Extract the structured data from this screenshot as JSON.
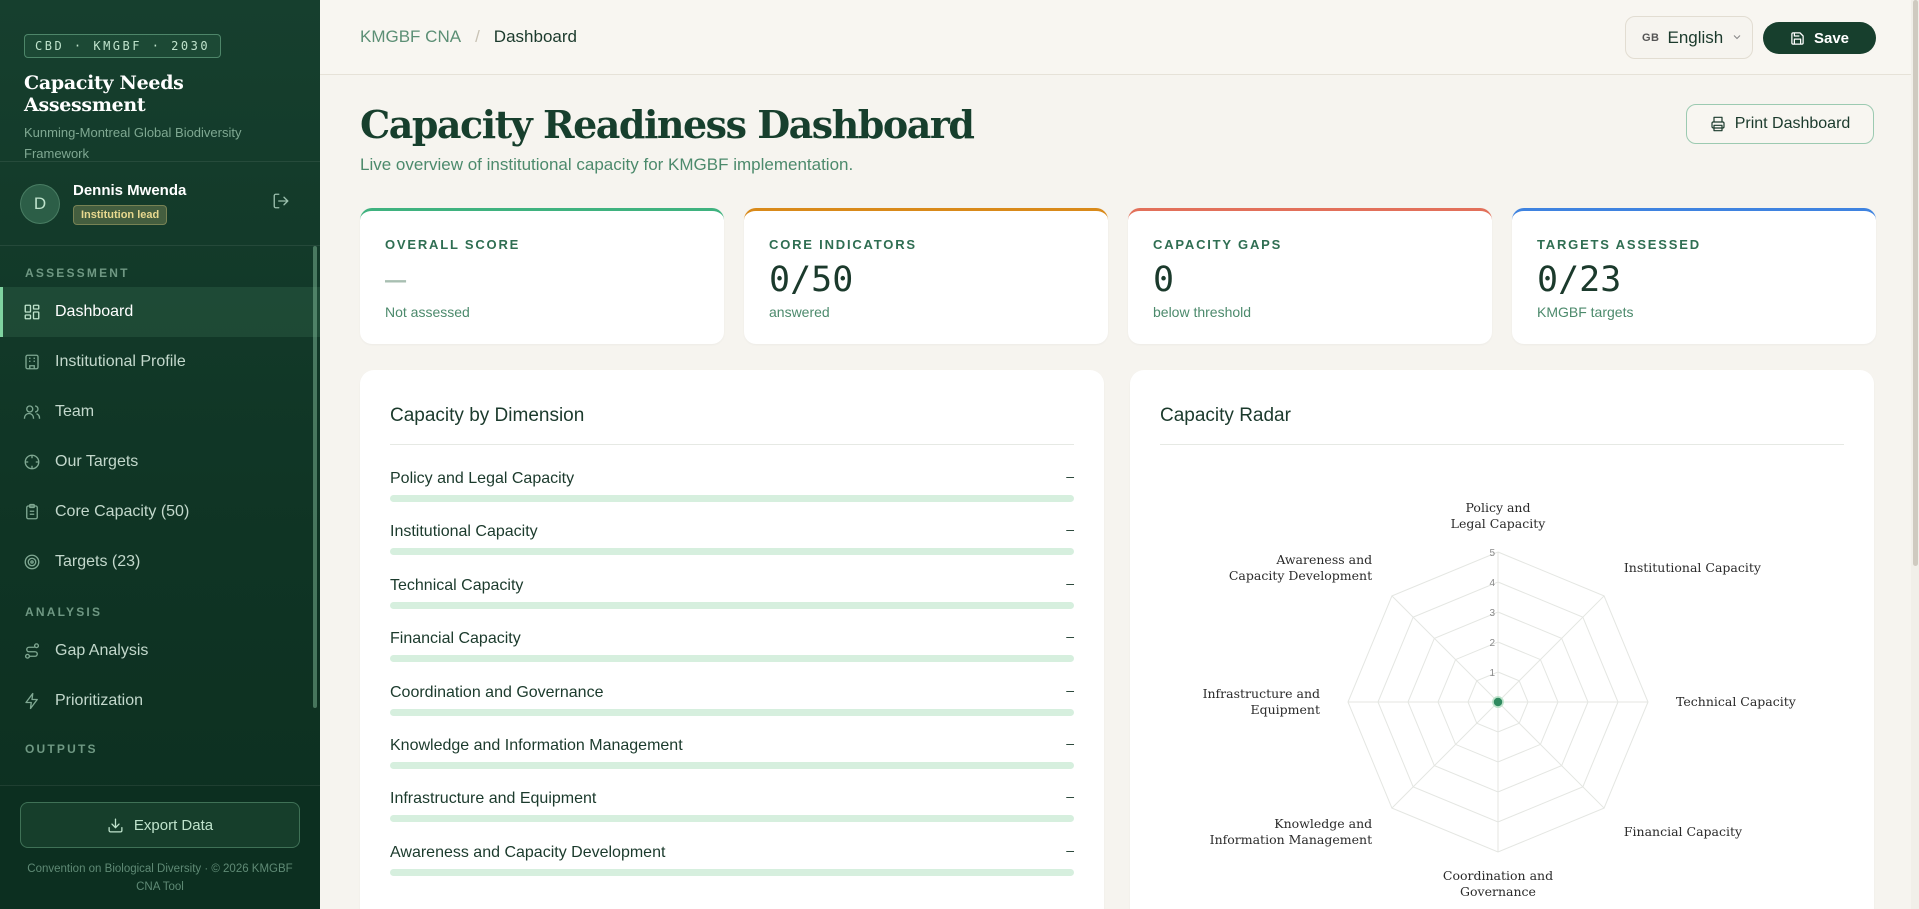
{
  "sidebar": {
    "tag": "CBD · KMGBF · 2030",
    "title": "Capacity Needs Assessment",
    "subtitle": "Kunming-Montreal Global Biodiversity Framework",
    "user": {
      "initial": "D",
      "name": "Dennis Mwenda",
      "role": "Institution lead"
    },
    "sections": {
      "assessment": "ASSESSMENT",
      "analysis": "ANALYSIS",
      "outputs": "OUTPUTS"
    },
    "items": [
      {
        "label": "Dashboard",
        "icon": "dashboard-grid-icon",
        "active": true
      },
      {
        "label": "Institutional Profile",
        "icon": "building-icon"
      },
      {
        "label": "Team",
        "icon": "users-icon"
      },
      {
        "label": "Our Targets",
        "icon": "crosshair-icon"
      },
      {
        "label": "Core Capacity (50)",
        "icon": "clipboard-icon"
      },
      {
        "label": "Targets (23)",
        "icon": "target-icon"
      },
      {
        "label": "Gap Analysis",
        "icon": "route-icon"
      },
      {
        "label": "Prioritization",
        "icon": "zap-icon"
      }
    ],
    "export_label": "Export Data",
    "footer": "Convention on Biological Diversity · © 2026 KMGBF CNA Tool"
  },
  "topbar": {
    "breadcrumb_root": "KMGBF CNA",
    "breadcrumb_sep": "/",
    "breadcrumb_current": "Dashboard",
    "language_flag": "GB",
    "language": "English",
    "save_label": "Save"
  },
  "page": {
    "title": "Capacity Readiness Dashboard",
    "subtitle": "Live overview of institutional capacity for KMGBF implementation.",
    "print_label": "Print Dashboard"
  },
  "stats": [
    {
      "label": "OVERALL SCORE",
      "value": "—",
      "note": "Not assessed",
      "color": "#3fb27f"
    },
    {
      "label": "CORE INDICATORS",
      "value": "0/50",
      "note": "answered",
      "color": "#d98a1a"
    },
    {
      "label": "CAPACITY GAPS",
      "value": "0",
      "note": "below threshold",
      "color": "#e2705a"
    },
    {
      "label": "TARGETS ASSESSED",
      "value": "0/23",
      "note": "KMGBF targets",
      "color": "#3f83e0"
    }
  ],
  "dimension_card": {
    "title": "Capacity by Dimension",
    "rows": [
      {
        "label": "Policy and Legal Capacity",
        "value": "–",
        "fill": 0
      },
      {
        "label": "Institutional Capacity",
        "value": "–",
        "fill": 0
      },
      {
        "label": "Technical Capacity",
        "value": "–",
        "fill": 0
      },
      {
        "label": "Financial Capacity",
        "value": "–",
        "fill": 0
      },
      {
        "label": "Coordination and Governance",
        "value": "–",
        "fill": 0
      },
      {
        "label": "Knowledge and Information Management",
        "value": "–",
        "fill": 0
      },
      {
        "label": "Infrastructure and Equipment",
        "value": "–",
        "fill": 0
      },
      {
        "label": "Awareness and Capacity Development",
        "value": "–",
        "fill": 0
      }
    ]
  },
  "radar_card": {
    "title": "Capacity Radar"
  },
  "chart_data": {
    "type": "radar",
    "title": "Capacity Radar",
    "axes": [
      [
        "Policy and",
        "Legal Capacity"
      ],
      [
        "Institutional Capacity"
      ],
      [
        "Technical Capacity"
      ],
      [
        "Financial Capacity"
      ],
      [
        "Coordination and",
        "Governance"
      ],
      [
        "Knowledge and",
        "Information Management"
      ],
      [
        "Infrastructure and",
        "Equipment"
      ],
      [
        "Awareness and",
        "Capacity Development"
      ]
    ],
    "scale": [
      1,
      2,
      3,
      4,
      5
    ],
    "rmax": 5,
    "values": [
      0,
      0,
      0,
      0,
      0,
      0,
      0,
      0
    ],
    "colors": {
      "series": "#2f8a5f",
      "grid": "#e4e6e2"
    }
  }
}
